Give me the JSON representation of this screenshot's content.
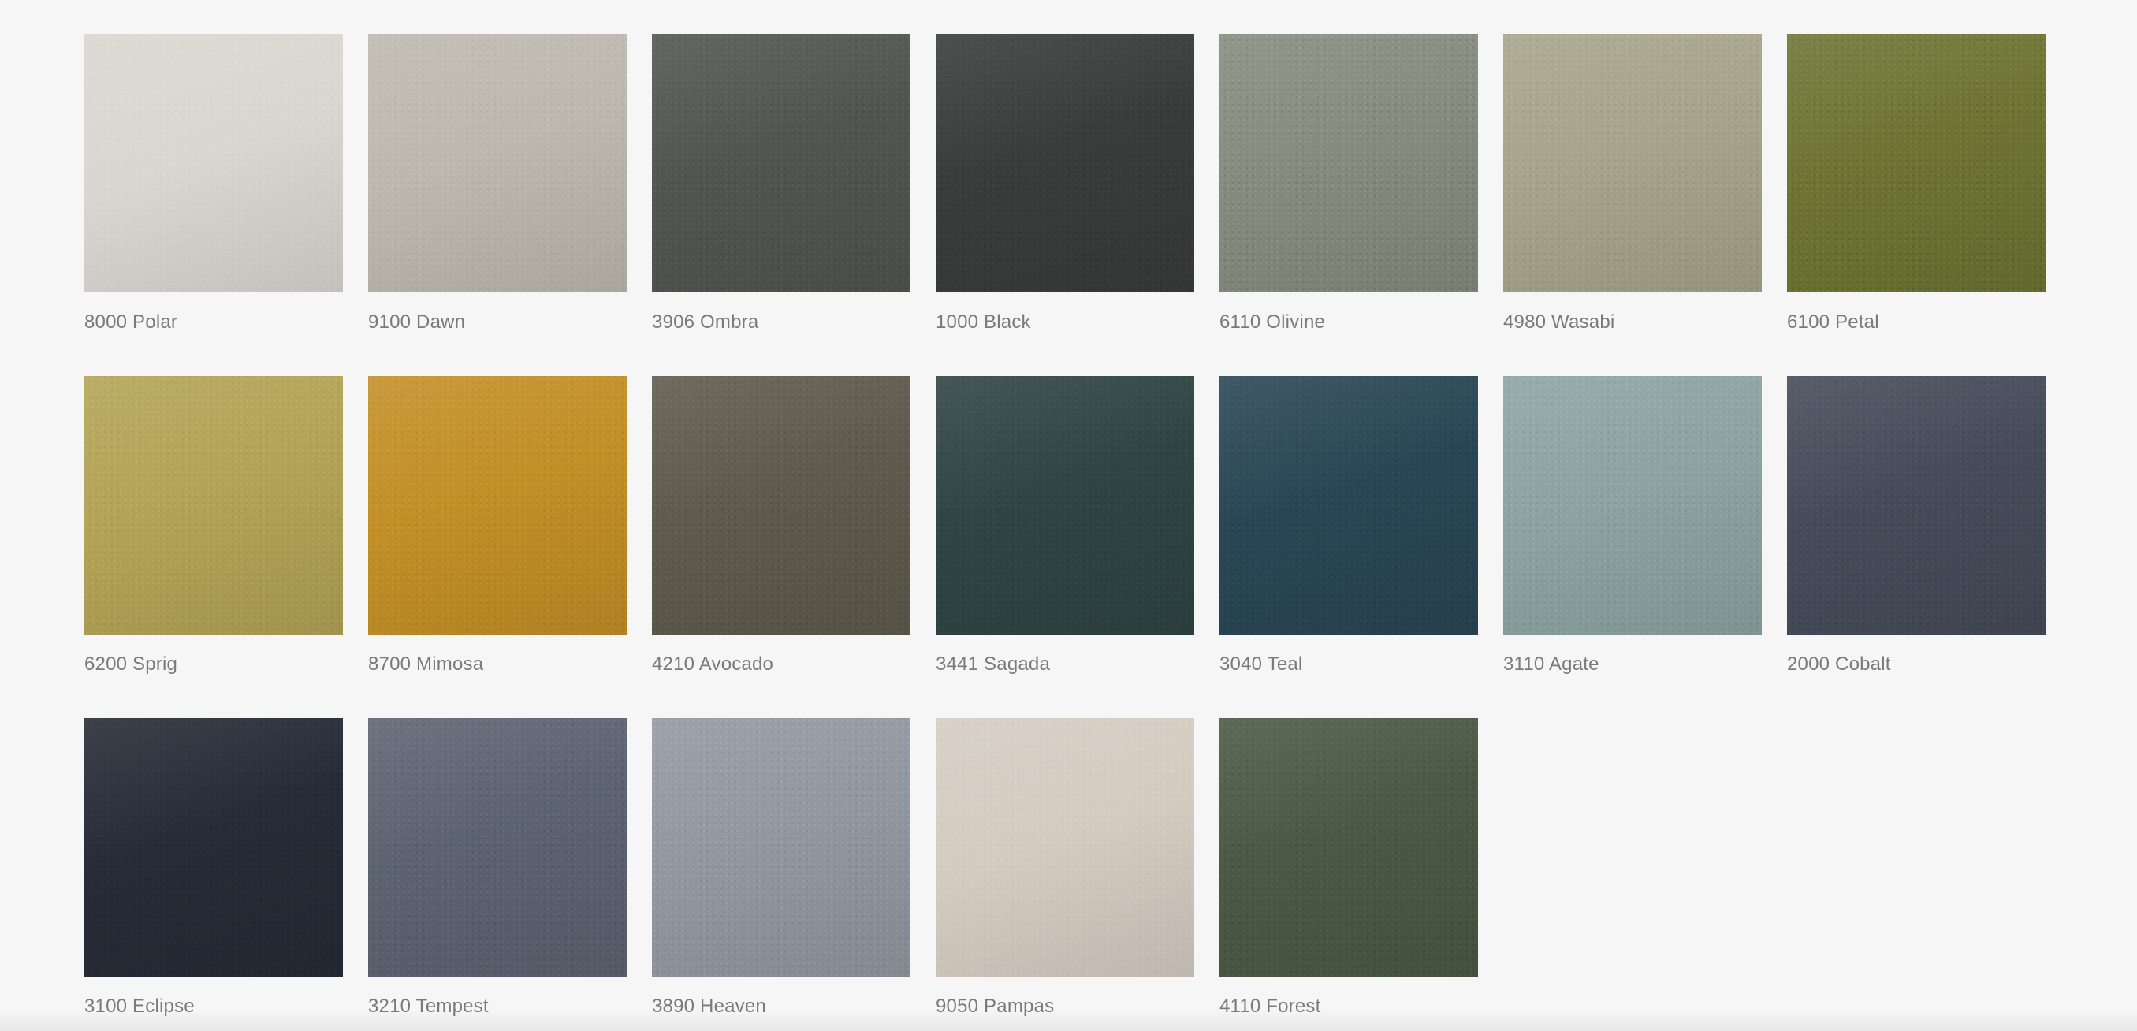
{
  "swatches": [
    {
      "label": "8000 Polar",
      "color": "#dad6d1"
    },
    {
      "label": "9100 Dawn",
      "color": "#bdb8af"
    },
    {
      "label": "3906 Ombra",
      "color": "#52554f"
    },
    {
      "label": "1000 Black",
      "color": "#3a3b3b"
    },
    {
      "label": "6110 Olivine",
      "color": "#858b7e"
    },
    {
      "label": "4980 Wasabi",
      "color": "#a6a48a"
    },
    {
      "label": "6100 Petal",
      "color": "#6e7334"
    },
    {
      "label": "6200 Sprig",
      "color": "#b3a356"
    },
    {
      "label": "8700 Mimosa",
      "color": "#c28f27"
    },
    {
      "label": "4210 Avocado",
      "color": "#5e5a4d"
    },
    {
      "label": "3441 Sagada",
      "color": "#2f4443"
    },
    {
      "label": "3040 Teal",
      "color": "#2a4654"
    },
    {
      "label": "3110 Agate",
      "color": "#8ca3a2"
    },
    {
      "label": "2000 Cobalt",
      "color": "#454b58"
    },
    {
      "label": "3100 Eclipse",
      "color": "#262b37"
    },
    {
      "label": "3210 Tempest",
      "color": "#5c6370"
    },
    {
      "label": "3890 Heaven",
      "color": "#9298a0"
    },
    {
      "label": "9050 Pampas",
      "color": "#d4ccc1"
    },
    {
      "label": "4110 Forest",
      "color": "#4a5945"
    }
  ]
}
